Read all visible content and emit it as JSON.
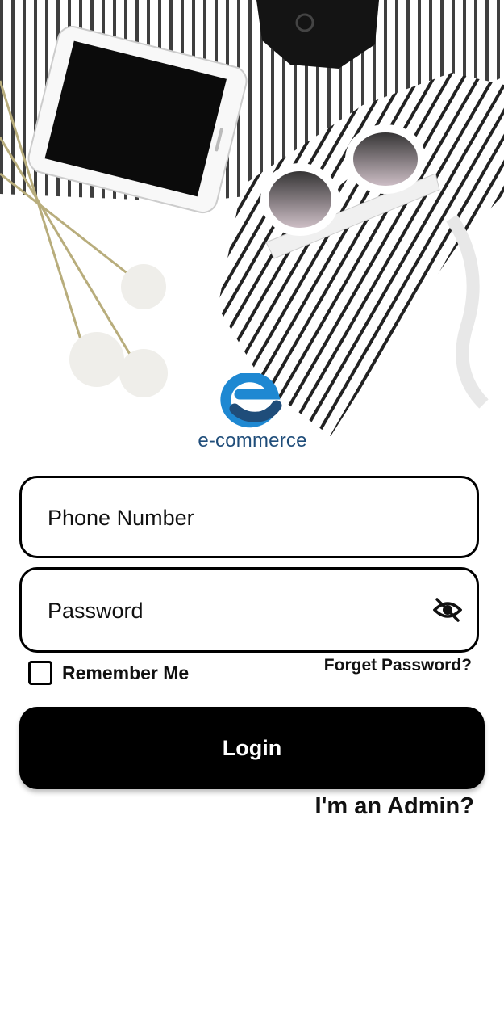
{
  "logo": {
    "text": "e-commerce"
  },
  "form": {
    "phone_placeholder": "Phone Number",
    "password_placeholder": "Password",
    "password_visibility_icon": "eye-off-icon",
    "remember_label": "Remember Me",
    "remember_checked": false,
    "forget_password_label": "Forget Password?",
    "login_label": "Login",
    "admin_link_label": "I'm an Admin?"
  },
  "colors": {
    "brand_dark": "#1f4d7a",
    "brand_light": "#1e88d2",
    "button": "#000000"
  }
}
